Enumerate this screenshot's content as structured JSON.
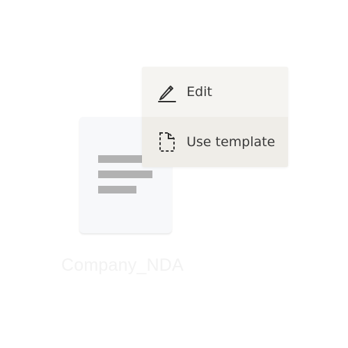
{
  "menu": {
    "items": [
      {
        "label": "Edit",
        "icon": "pencil-icon",
        "highlighted": false
      },
      {
        "label": "Use template",
        "icon": "template-file-icon",
        "highlighted": true
      }
    ],
    "colors": {
      "background": "#f5f4f1",
      "highlight": "#efede8",
      "text": "#3b3b3b"
    }
  },
  "document": {
    "name": "Company_NDA",
    "icon": "document-thumbnail-icon"
  }
}
